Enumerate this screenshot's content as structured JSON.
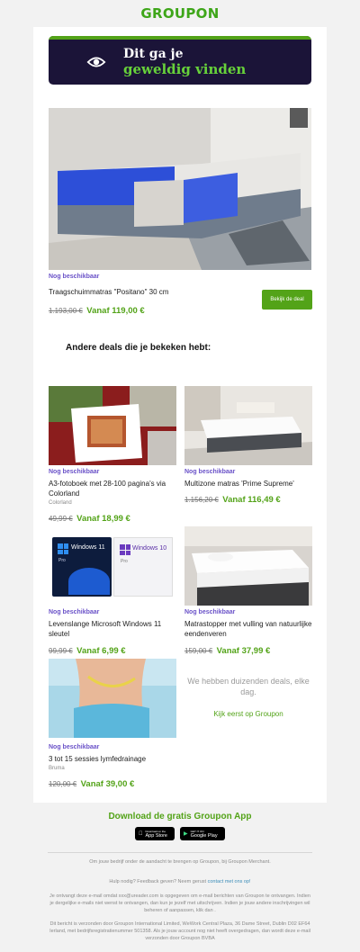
{
  "header": {
    "logo": "GROUPON"
  },
  "hero": {
    "line1": "Dit ga je",
    "line2": "geweldig vinden"
  },
  "main_deal": {
    "availability": "Nog beschikbaar",
    "title": "Traagschuimmatras \"Positano\" 30 cm",
    "old_price": "1.193,00 €",
    "new_price": "Vanaf 119,00 €",
    "button": "Bekijk de deal"
  },
  "section_title": "Andere deals die je bekeken hebt:",
  "deals": [
    {
      "availability": "Nog beschikbaar",
      "title": "A3-fotoboek met 28-100 pagina's via Colorland",
      "merchant": "Colorland",
      "old_price": "49,99 €",
      "new_price": "Vanaf 18,99 €"
    },
    {
      "availability": "Nog beschikbaar",
      "title": "Multizone matras 'Prime Supreme'",
      "merchant": "",
      "old_price": "1.156,20 €",
      "new_price": "Vanaf 116,49 €"
    },
    {
      "availability": "Nog beschikbaar",
      "title": "Levenslange Microsoft Windows 11 sleutel",
      "merchant": "",
      "old_price": "99,99 €",
      "new_price": "Vanaf 6,99 €",
      "img_text": {
        "win11": "Windows 11",
        "win10": "Windows 10",
        "pro": "Pro"
      }
    },
    {
      "availability": "Nog beschikbaar",
      "title": "Matrastopper met vulling van natuurlijke eendenveren",
      "merchant": "",
      "old_price": "159,00 €",
      "new_price": "Vanaf 37,99 €"
    },
    {
      "availability": "Nog beschikbaar",
      "title": "3 tot 15 sessies lymfedrainage",
      "merchant": "Bruma",
      "old_price": "120,00 €",
      "new_price": "Vanaf 39,00 €"
    }
  ],
  "promo": {
    "text": "We hebben duizenden deals, elke dag.",
    "link": "Kijk eerst op Groupon"
  },
  "app": {
    "heading": "Download de gratis Groupon App",
    "appstore_small": "Download on the",
    "appstore": "App Store",
    "gplay_small": "GET IT ON",
    "gplay": "Google Play"
  },
  "footer": {
    "merchant_note": "Om jouw bedrijf onder de aandacht te brengen op Groupon, bij Groupon Merchant.",
    "help": "Hulp nodig? Feedback geven? Neem gerust",
    "help_link": "contact met ons op!",
    "email_note": "Je ontvangt deze e-mail omdat xxx@ureader.com is opgegeven om e-mail berichten van Groupon te ontvangen. Indien je dergelijke e-mails niet wenst te ontvangen, dan kun je jezelf met uitschrijven. Indien je jouw andere inschrijvingen wil beheren of aanpassen, klik dan .",
    "sender_note": "Dit bericht is verzonden door Groupon International Limited, WeWork Central Plaza, 36 Dame Street, Dublin D02 EF64 Ierland, met bedrijfsregistratienummer 501358. Als je jouw account nog niet heeft overgedragen, dan wordt deze e-mail verzonden door Groupon BVBA"
  }
}
